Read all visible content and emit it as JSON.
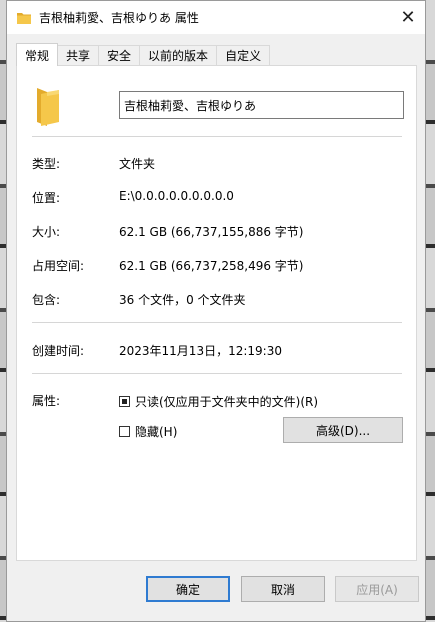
{
  "window": {
    "title": "吉根柚莉愛、吉根ゆりあ 属性",
    "close_glyph": "✕"
  },
  "tabs": [
    {
      "label": "常规",
      "active": true
    },
    {
      "label": "共享",
      "active": false
    },
    {
      "label": "安全",
      "active": false
    },
    {
      "label": "以前的版本",
      "active": false
    },
    {
      "label": "自定义",
      "active": false
    }
  ],
  "general": {
    "name_value": "吉根柚莉愛、吉根ゆりあ",
    "type_label": "类型:",
    "type_value": "文件夹",
    "location_label": "位置:",
    "location_value": "E:\\0.0.0.0.0.0.0.0.0",
    "size_label": "大小:",
    "size_value": "62.1 GB (66,737,155,886 字节)",
    "size_on_disk_label": "占用空间:",
    "size_on_disk_value": "62.1 GB (66,737,258,496 字节)",
    "contains_label": "包含:",
    "contains_value": "36 个文件，0 个文件夹",
    "created_label": "创建时间:",
    "created_value": "2023年11月13日，12:19:30",
    "attributes_label": "属性:",
    "readonly_label": "只读(仅应用于文件夹中的文件)(R)",
    "readonly_state": "indeterminate",
    "hidden_label": "隐藏(H)",
    "hidden_state": "unchecked",
    "advanced_button": "高级(D)..."
  },
  "footer": {
    "ok_label": "确定",
    "cancel_label": "取消",
    "apply_label": "应用(A)"
  },
  "colors": {
    "folder_yellow": "#f5c74a",
    "folder_yellow_dark": "#e3ab2c",
    "primary_border": "#2f7bd1"
  }
}
